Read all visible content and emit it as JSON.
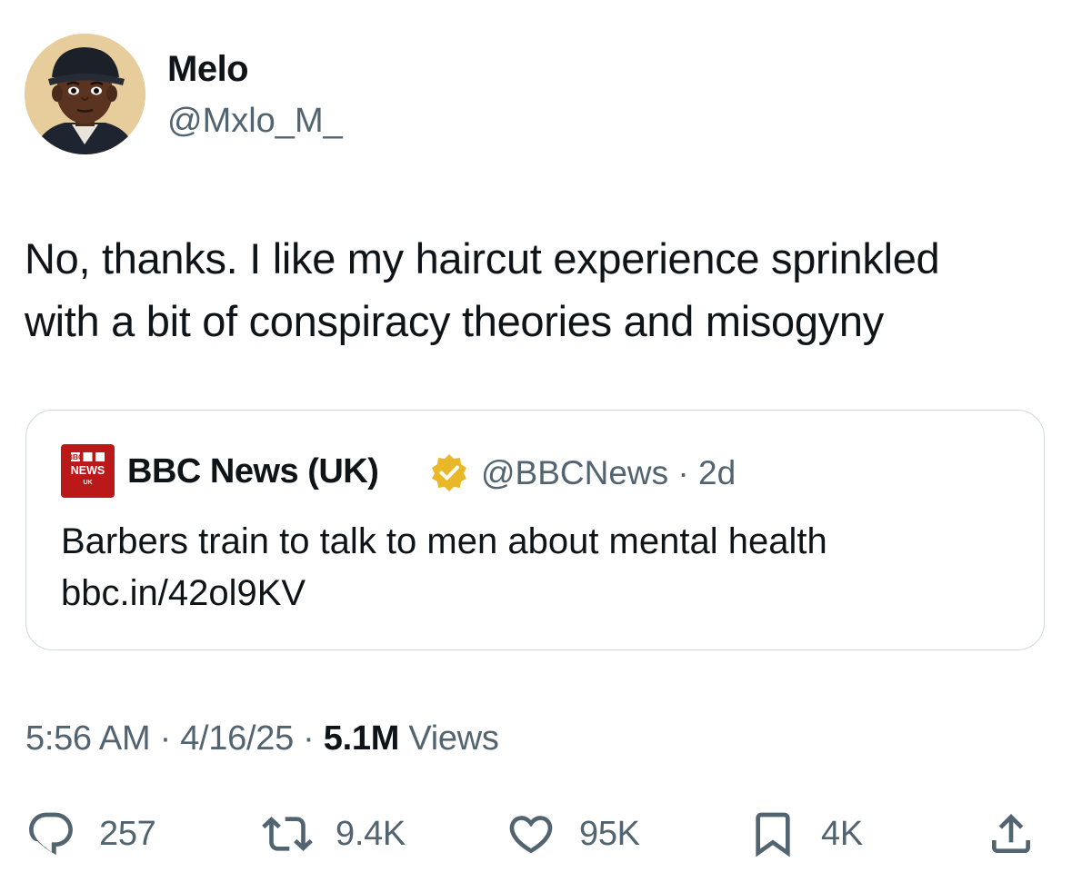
{
  "author": {
    "display_name": "Melo",
    "handle": "@Mxlo_M_",
    "avatar_icon": "cartoon-avatar"
  },
  "tweet": {
    "text_lines": [
      "No, thanks. I like my haircut experience sprinkled",
      "with a bit of conspiracy theories and misogyny"
    ]
  },
  "quote": {
    "logo_lines": [
      "BBC",
      "NEWS",
      "UK"
    ],
    "name": "BBC News (UK)",
    "verified_icon": "verified-gold-badge",
    "handle_time": "@BBCNews · 2d",
    "text_lines": [
      "Barbers train to talk to men about mental health",
      "bbc.in/42ol9KV"
    ]
  },
  "meta": {
    "time": "5:56 AM",
    "date": "4/16/25",
    "views_count": "5.1M",
    "views_label": "Views",
    "separator": "·"
  },
  "actions": {
    "replies": "257",
    "reposts": "9.4K",
    "likes": "95K",
    "bookmarks": "4K"
  },
  "colors": {
    "text": "#0f1419",
    "secondary": "#536471",
    "border": "#cfd9de",
    "bbc_red": "#bb1919",
    "verified_gold": "#e8b829"
  }
}
